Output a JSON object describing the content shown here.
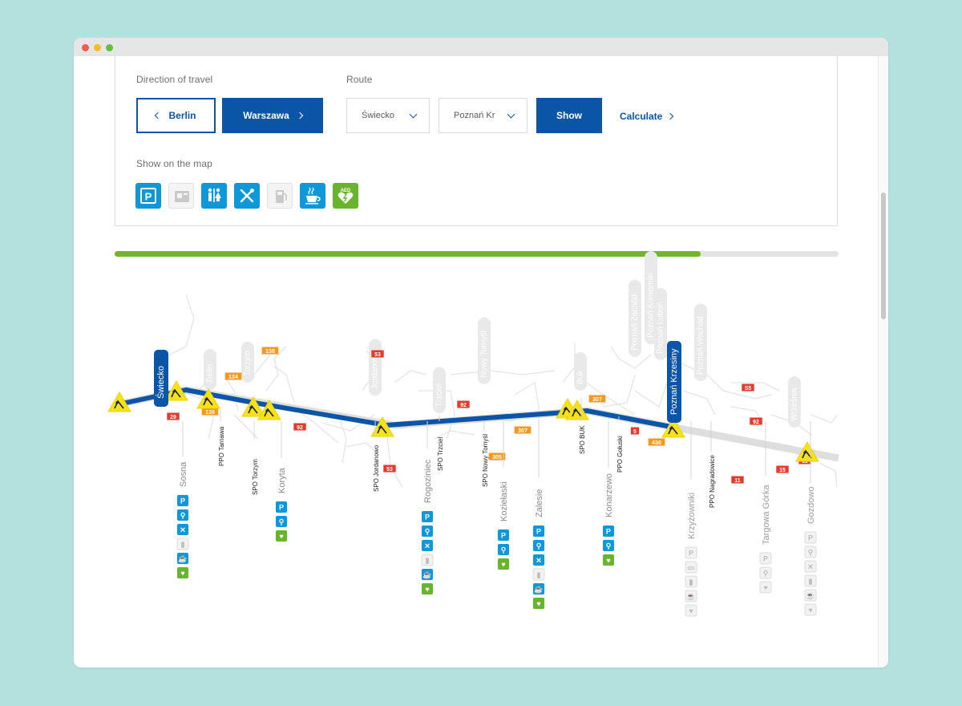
{
  "colors": {
    "accent": "#0b55a6",
    "service_blue": "#0e98d9",
    "aed_green": "#68b42d",
    "progress_green": "#72b52c",
    "warning_yellow": "#f5e21b",
    "road_number_red": "#e53a2b",
    "road_number_orange": "#f39a1e"
  },
  "controls": {
    "direction_label": "Direction of travel",
    "route_label": "Route",
    "dir_berlin": "Berlin",
    "dir_warszawa": "Warszawa",
    "route_from": "Świecko",
    "route_to": "Poznań Kr",
    "show": "Show",
    "calculate": "Calculate",
    "show_on_map": "Show on the map"
  },
  "filters": [
    {
      "id": "parking",
      "icon": "parking-icon",
      "active": true
    },
    {
      "id": "atm",
      "icon": "atm-icon",
      "active": false
    },
    {
      "id": "toilets",
      "icon": "toilets-icon",
      "active": true
    },
    {
      "id": "restaurant",
      "icon": "restaurant-icon",
      "active": true
    },
    {
      "id": "fuel",
      "icon": "fuel-station-icon",
      "active": false
    },
    {
      "id": "cafe",
      "icon": "coffee-icon",
      "active": true
    },
    {
      "id": "aed",
      "icon": "aed-defibrillator-icon",
      "active": true,
      "label": "AED"
    }
  ],
  "progress": 0.81,
  "route_ends": {
    "start": "Świecko",
    "end": "Poznań Krzesiny"
  },
  "map": {
    "exits": [
      {
        "name": "Zielin",
        "active": false
      },
      {
        "name": "Torzym",
        "active": false
      },
      {
        "name": "Jordanowo",
        "active": false
      },
      {
        "name": "Trzciel",
        "active": false
      },
      {
        "name": "Nowy Tomyśl",
        "active": false
      },
      {
        "name": "Buk",
        "active": false
      },
      {
        "name": "Poznań Zachód",
        "active": false
      },
      {
        "name": "Poznań Komorniki",
        "active": false
      },
      {
        "name": "Poznań Luboń",
        "active": false
      },
      {
        "name": "Poznań Wschód",
        "active": false
      },
      {
        "name": "Września",
        "active": false
      }
    ],
    "road_numbers": [
      {
        "num": "29",
        "color": "red"
      },
      {
        "num": "138",
        "color": "orange"
      },
      {
        "num": "134",
        "color": "orange"
      },
      {
        "num": "138",
        "color": "orange"
      },
      {
        "num": "92",
        "color": "red"
      },
      {
        "num": "53",
        "color": "red"
      },
      {
        "num": "53",
        "color": "red"
      },
      {
        "num": "92",
        "color": "red"
      },
      {
        "num": "307",
        "color": "orange"
      },
      {
        "num": "305",
        "color": "orange"
      },
      {
        "num": "307",
        "color": "orange"
      },
      {
        "num": "5",
        "color": "red"
      },
      {
        "num": "430",
        "color": "orange"
      },
      {
        "num": "S5",
        "color": "red"
      },
      {
        "num": "92",
        "color": "red"
      },
      {
        "num": "11",
        "color": "red"
      },
      {
        "num": "15",
        "color": "red"
      },
      {
        "num": "11",
        "color": "red"
      }
    ],
    "service_areas": [
      {
        "name": "Sosna",
        "services": [
          "parking",
          "toilets",
          "restaurant",
          "fuel",
          "cafe",
          "aed"
        ],
        "active": true
      },
      {
        "name": "PPO Tarnawa",
        "services": [],
        "active": true
      },
      {
        "name": "SPO Torzym",
        "services": [],
        "active": true
      },
      {
        "name": "Koryta",
        "services": [
          "parking",
          "toilets",
          "aed"
        ],
        "active": true
      },
      {
        "name": "SPO Jordanowo",
        "services": [],
        "active": true
      },
      {
        "name": "Rogoziniec",
        "services": [
          "parking",
          "toilets",
          "restaurant",
          "fuel",
          "cafe",
          "aed"
        ],
        "active": true
      },
      {
        "name": "SPO Trzciel",
        "services": [],
        "active": true
      },
      {
        "name": "SPO Nowy Tomyśl",
        "services": [],
        "active": true
      },
      {
        "name": "Koziełaski",
        "services": [
          "parking",
          "toilets",
          "aed"
        ],
        "active": true
      },
      {
        "name": "Zalesie",
        "services": [
          "parking",
          "toilets",
          "restaurant",
          "fuel",
          "cafe",
          "aed"
        ],
        "active": true
      },
      {
        "name": "SPO BUK",
        "services": [],
        "active": true
      },
      {
        "name": "PPO Gołuski",
        "services": [],
        "active": true
      },
      {
        "name": "Konarzewo",
        "services": [
          "parking",
          "toilets",
          "aed"
        ],
        "active": true
      },
      {
        "name": "Krzyżowniki",
        "services": [
          "parking",
          "atm",
          "fuel",
          "cafe",
          "aed"
        ],
        "active": false
      },
      {
        "name": "PPO Nagradowice",
        "services": [],
        "active": true
      },
      {
        "name": "Targowa Górka",
        "services": [
          "parking",
          "toilets",
          "aed"
        ],
        "active": false
      },
      {
        "name": "Gozdowo",
        "services": [
          "parking",
          "toilets",
          "restaurant",
          "fuel",
          "cafe",
          "aed"
        ],
        "active": false
      }
    ]
  }
}
